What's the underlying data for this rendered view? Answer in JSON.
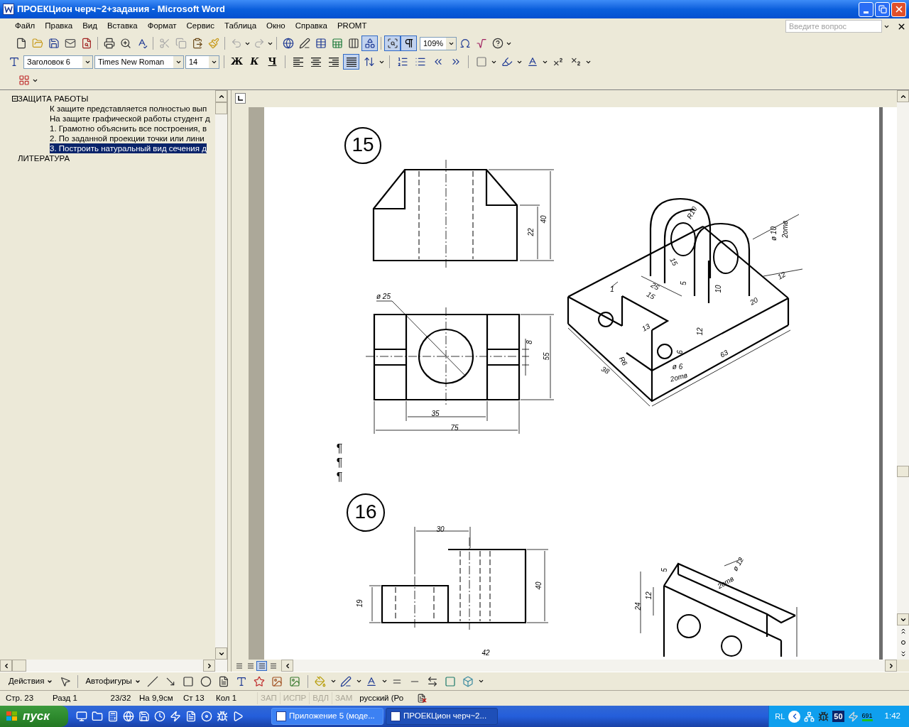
{
  "window": {
    "title": "ПРОЕКЦион черч~2+задания - Microsoft Word"
  },
  "menu": [
    "Файл",
    "Правка",
    "Вид",
    "Вставка",
    "Формат",
    "Сервис",
    "Таблица",
    "Окно",
    "Справка",
    "PROMT"
  ],
  "help_box": {
    "placeholder": "Введите вопрос"
  },
  "standard_toolbar": {
    "zoom": "109%",
    "drawing_pressed": true,
    "document_map_pressed": true,
    "show_marks_pressed": true
  },
  "formatting_toolbar": {
    "style": "Заголовок 6",
    "font": "Times New Roman",
    "size": "14",
    "bold": "Ж",
    "italic": "К",
    "underline": "Ч",
    "justify_pressed": true
  },
  "outline": {
    "items": [
      {
        "text": "ЗАЩИТА РАБОТЫ",
        "expanded": true,
        "selected": false,
        "children": [
          {
            "text": "К защите представляется полностью вып",
            "selected": false
          },
          {
            "text": "На защите графической работы студент д",
            "selected": false
          },
          {
            "text": "1. Грамотно объяснить все построения, в",
            "selected": false
          },
          {
            "text": "2. По заданной проекции точки или лини",
            "selected": false
          },
          {
            "text": "3. Построить натуральный вид сечения д",
            "selected": true
          }
        ]
      },
      {
        "text": "ЛИТЕРАТУРА",
        "selected": false
      }
    ]
  },
  "document": {
    "paragraph_marks": [
      "¶",
      "¶",
      "¶"
    ],
    "figures": [
      {
        "number": "15",
        "labels": [
          "40",
          "22",
          "ø 25",
          "8",
          "55",
          "35",
          "75",
          "R10",
          "ø 10",
          "2отв",
          "15",
          "25",
          "5",
          "10",
          "20",
          "12",
          "1",
          "15",
          "13",
          "12",
          "R6",
          "6",
          "ø 6",
          "2отв",
          "63",
          "38"
        ]
      },
      {
        "number": "16",
        "labels": [
          "30",
          "40",
          "19",
          "42",
          "5",
          "ø 12",
          "2отв",
          "12",
          "24"
        ]
      }
    ]
  },
  "drawing_toolbar": {
    "actions": "Действия",
    "autoshapes": "Автофигуры"
  },
  "status_bar": {
    "page": "Стр. 23",
    "section": "Разд 1",
    "pages": "23/32",
    "position": "На 9,9см",
    "line": "Ст 13",
    "column": "Кол 1",
    "modes": [
      {
        "label": "ЗАП",
        "on": false
      },
      {
        "label": "ИСПР",
        "on": false
      },
      {
        "label": "ВДЛ",
        "on": false
      },
      {
        "label": "ЗАМ",
        "on": false
      }
    ],
    "language": "русский (Ро"
  },
  "taskbar": {
    "start": "пуск",
    "tasks": [
      {
        "label": "Приложение 5 (моде...",
        "selected": false
      },
      {
        "label": "ПРОЕКЦион черч~2...",
        "selected": true
      }
    ],
    "tray": {
      "language": "RL",
      "badge": "50",
      "counter": "691",
      "clock": "1:42"
    }
  }
}
